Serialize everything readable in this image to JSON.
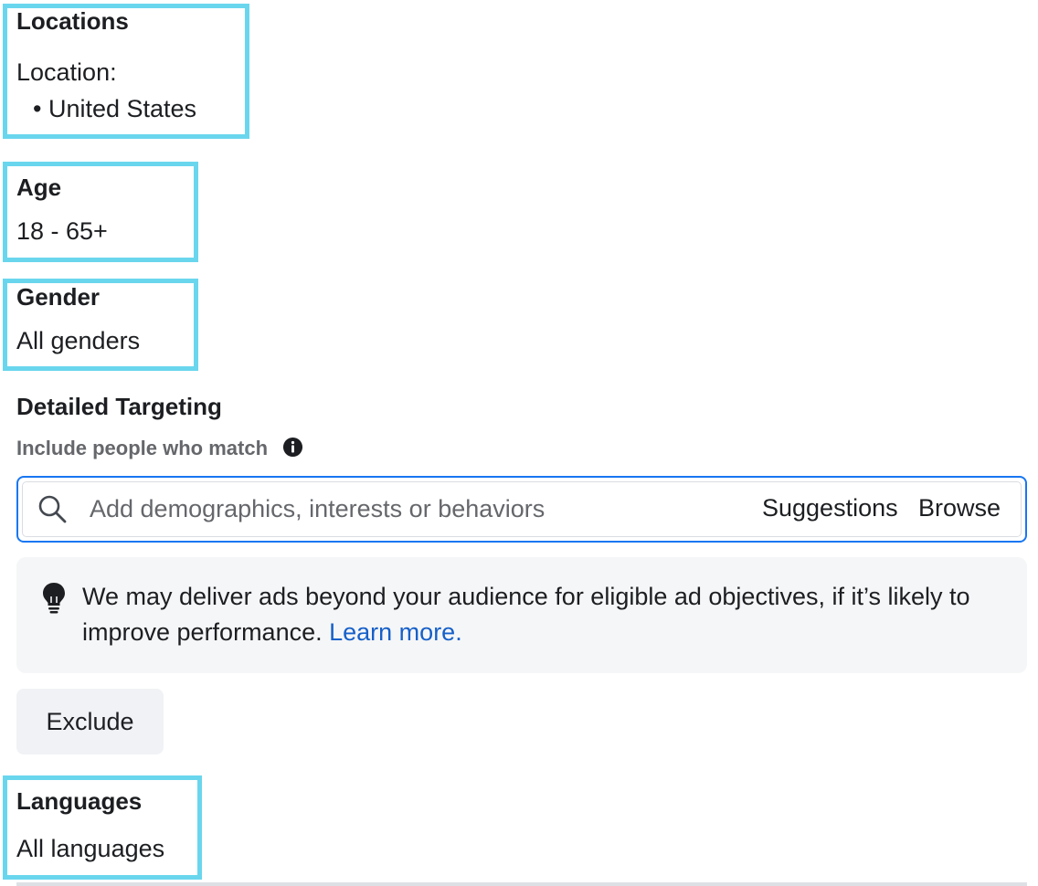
{
  "locations": {
    "title": "Locations",
    "label": "Location:",
    "items": [
      "United States"
    ]
  },
  "age": {
    "title": "Age",
    "value": "18 - 65+"
  },
  "gender": {
    "title": "Gender",
    "value": "All genders"
  },
  "detailed_targeting": {
    "title": "Detailed Targeting",
    "subtitle": "Include people who match",
    "info_icon": "info-icon",
    "search": {
      "icon": "search-icon",
      "placeholder": "Add demographics, interests or behaviors",
      "value": "",
      "suggestions_label": "Suggestions",
      "browse_label": "Browse"
    },
    "notice": {
      "icon": "lightbulb-icon",
      "text": "We may deliver ads beyond your audience for eligible ad objectives, if it’s likely to improve performance.",
      "link_label": "Learn more."
    },
    "exclude_label": "Exclude"
  },
  "languages": {
    "title": "Languages",
    "value": "All languages"
  },
  "colors": {
    "highlight": "#6ad6ee",
    "accent": "#1877f2",
    "link": "#1660c9",
    "muted_text": "#65676b"
  }
}
